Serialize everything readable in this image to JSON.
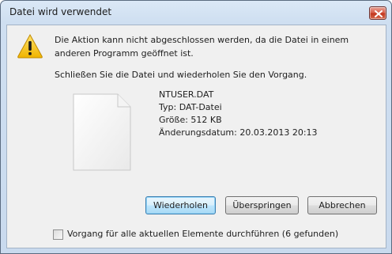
{
  "window": {
    "title": "Datei wird verwendet"
  },
  "message": {
    "line1": "Die Aktion kann nicht abgeschlossen werden, da die Datei in einem anderen Programm geöffnet ist.",
    "line2": "Schließen Sie die Datei und wiederholen Sie den Vorgang."
  },
  "file": {
    "name": "NTUSER.DAT",
    "type": "Typ: DAT-Datei",
    "size": "Größe: 512 KB",
    "modified": "Änderungsdatum: 20.03.2013 20:13"
  },
  "buttons": {
    "retry": "Wiederholen",
    "skip": "Überspringen",
    "cancel": "Abbrechen"
  },
  "checkbox": {
    "label": "Vorgang für alle aktuellen Elemente durchführen (6 gefunden)",
    "checked": false
  },
  "colors": {
    "warning": "#f5c400",
    "close_button": "#c2361d"
  },
  "icons": [
    "warning-icon",
    "file-icon",
    "close-icon"
  ]
}
